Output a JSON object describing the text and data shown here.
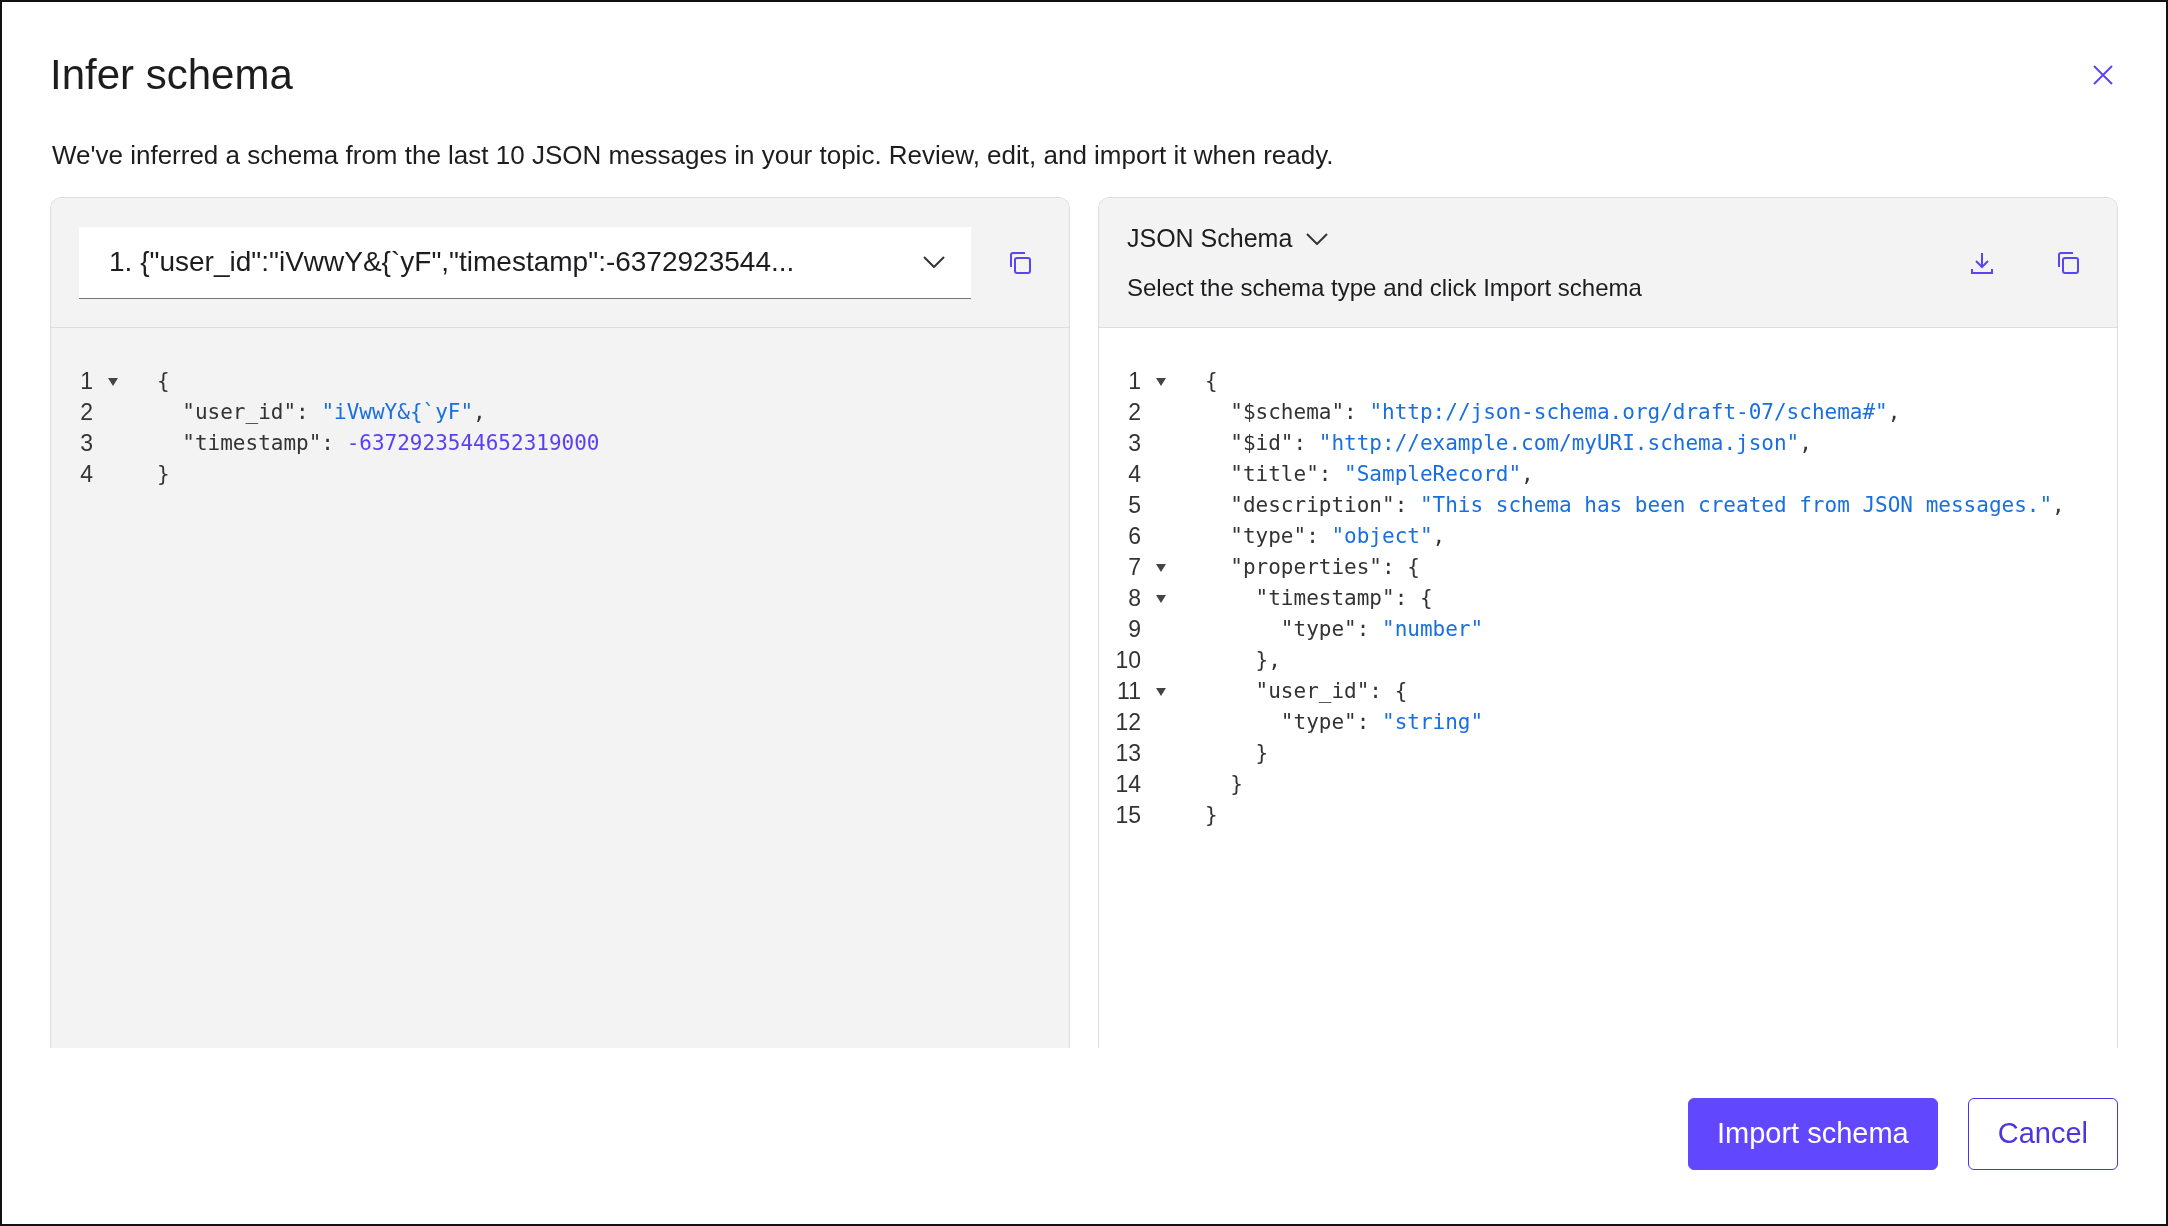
{
  "dialog": {
    "title": "Infer schema",
    "description": "We've inferred a schema from the last 10 JSON messages in your topic. Review, edit, and import it when ready."
  },
  "message_panel": {
    "selector_value": "1. {\"user_id\":\"iVwwY&{`yF\",\"timestamp\":-6372923544...",
    "code": [
      {
        "number": "1",
        "foldable": true,
        "tokens": [
          {
            "kind": "text",
            "text": "{"
          }
        ]
      },
      {
        "number": "2",
        "foldable": false,
        "tokens": [
          {
            "kind": "text",
            "text": "  \"user_id\": "
          },
          {
            "kind": "string",
            "text": "\"iVwwY&{`yF\""
          },
          {
            "kind": "text",
            "text": ","
          }
        ]
      },
      {
        "number": "3",
        "foldable": false,
        "tokens": [
          {
            "kind": "text",
            "text": "  \"timestamp\": "
          },
          {
            "kind": "number",
            "text": "-6372923544652319000"
          }
        ]
      },
      {
        "number": "4",
        "foldable": false,
        "tokens": [
          {
            "kind": "text",
            "text": "}"
          }
        ]
      }
    ]
  },
  "schema_panel": {
    "schema_type": "JSON Schema",
    "hint": "Select the schema type and click Import schema",
    "code": [
      {
        "number": "1",
        "foldable": true,
        "tokens": [
          {
            "kind": "text",
            "text": "{"
          }
        ]
      },
      {
        "number": "2",
        "foldable": false,
        "tokens": [
          {
            "kind": "text",
            "text": "  \"$schema\": "
          },
          {
            "kind": "string",
            "text": "\"http://json-schema.org/draft-07/schema#\""
          },
          {
            "kind": "text",
            "text": ","
          }
        ]
      },
      {
        "number": "3",
        "foldable": false,
        "tokens": [
          {
            "kind": "text",
            "text": "  \"$id\": "
          },
          {
            "kind": "string",
            "text": "\"http://example.com/myURI.schema.json\""
          },
          {
            "kind": "text",
            "text": ","
          }
        ]
      },
      {
        "number": "4",
        "foldable": false,
        "tokens": [
          {
            "kind": "text",
            "text": "  \"title\": "
          },
          {
            "kind": "string",
            "text": "\"SampleRecord\""
          },
          {
            "kind": "text",
            "text": ","
          }
        ]
      },
      {
        "number": "5",
        "foldable": false,
        "tokens": [
          {
            "kind": "text",
            "text": "  \"description\": "
          },
          {
            "kind": "string",
            "text": "\"This schema has been created from JSON messages.\""
          },
          {
            "kind": "text",
            "text": ","
          }
        ]
      },
      {
        "number": "6",
        "foldable": false,
        "tokens": [
          {
            "kind": "text",
            "text": "  \"type\": "
          },
          {
            "kind": "string",
            "text": "\"object\""
          },
          {
            "kind": "text",
            "text": ","
          }
        ]
      },
      {
        "number": "7",
        "foldable": true,
        "tokens": [
          {
            "kind": "text",
            "text": "  \"properties\": {"
          }
        ]
      },
      {
        "number": "8",
        "foldable": true,
        "tokens": [
          {
            "kind": "text",
            "text": "    \"timestamp\": {"
          }
        ]
      },
      {
        "number": "9",
        "foldable": false,
        "tokens": [
          {
            "kind": "text",
            "text": "      \"type\": "
          },
          {
            "kind": "string",
            "text": "\"number\""
          }
        ]
      },
      {
        "number": "10",
        "foldable": false,
        "tokens": [
          {
            "kind": "text",
            "text": "    },"
          }
        ]
      },
      {
        "number": "11",
        "foldable": true,
        "tokens": [
          {
            "kind": "text",
            "text": "    \"user_id\": {"
          }
        ]
      },
      {
        "number": "12",
        "foldable": false,
        "tokens": [
          {
            "kind": "text",
            "text": "      \"type\": "
          },
          {
            "kind": "string",
            "text": "\"string\""
          }
        ]
      },
      {
        "number": "13",
        "foldable": false,
        "tokens": [
          {
            "kind": "text",
            "text": "    }"
          }
        ]
      },
      {
        "number": "14",
        "foldable": false,
        "tokens": [
          {
            "kind": "text",
            "text": "  }"
          }
        ]
      },
      {
        "number": "15",
        "foldable": false,
        "tokens": [
          {
            "kind": "text",
            "text": "}"
          }
        ]
      }
    ]
  },
  "buttons": [
    {
      "label": "Import schema",
      "kind": "primary"
    },
    {
      "label": "Cancel",
      "kind": "secondary"
    }
  ]
}
